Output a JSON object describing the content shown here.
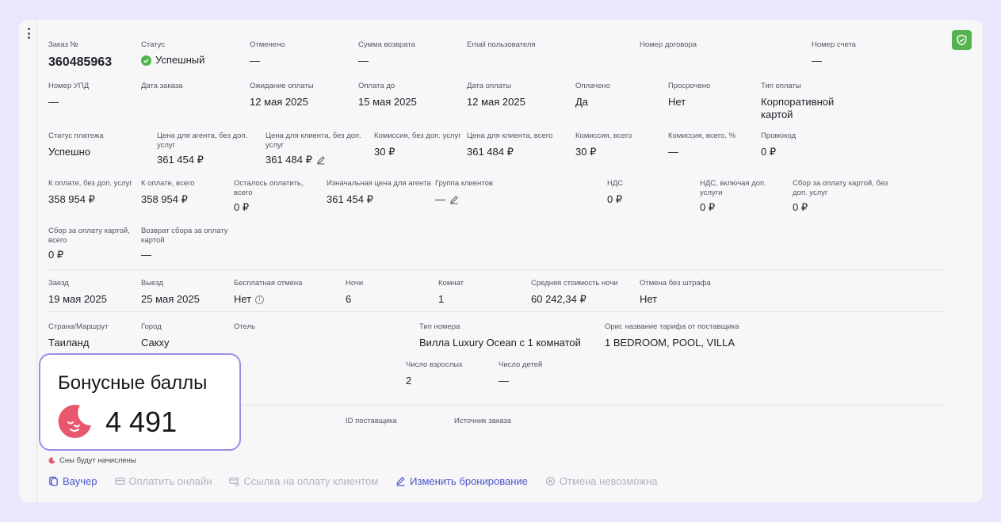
{
  "order": {
    "row1": [
      {
        "label": "Заказ №",
        "value": "360485963"
      },
      {
        "label": "Статус",
        "value": "Успешный"
      },
      {
        "label": "Отменено",
        "value": "—"
      },
      {
        "label": "Сумма возврата",
        "value": "—"
      },
      {
        "label": "Email пользователя",
        "value": ""
      },
      {
        "label": "Номер договора",
        "value": ""
      },
      {
        "label": "Номер счета",
        "value": "—"
      }
    ],
    "row2": [
      {
        "label": "Номер УПД",
        "value": "—"
      },
      {
        "label": "Дата заказа",
        "value": ""
      },
      {
        "label": "Ожидание оплаты",
        "value": "12 мая 2025"
      },
      {
        "label": "Оплата до",
        "value": "15 мая 2025"
      },
      {
        "label": "Дата оплаты",
        "value": "12 мая 2025"
      },
      {
        "label": "Оплачено",
        "value": "Да"
      },
      {
        "label": "Просрочено",
        "value": "Нет"
      },
      {
        "label": "Тип оплаты",
        "value": "Корпоративной картой"
      }
    ],
    "row3": [
      {
        "label": "Статус платежа",
        "value": "Успешно"
      },
      {
        "label": "Цена для агента, без доп. услуг",
        "value": "361 454 ₽"
      },
      {
        "label": "Цена для клиента, без доп. услуг",
        "value": "361 484 ₽"
      },
      {
        "label": "Комиссия, без доп. услуг",
        "value": "30 ₽"
      },
      {
        "label": "Цена для клиента, всего",
        "value": "361 484 ₽"
      },
      {
        "label": "Комиссия, всего",
        "value": "30 ₽"
      },
      {
        "label": "Комиссия, всего, %",
        "value": "—"
      },
      {
        "label": "Промокод",
        "value": "0 ₽"
      }
    ],
    "row4": [
      {
        "label": "К оплате, без доп. услуг",
        "value": "358 954 ₽"
      },
      {
        "label": "К оплате, всего",
        "value": "358 954 ₽"
      },
      {
        "label": "Осталось оплатить, всего",
        "value": "0 ₽"
      },
      {
        "label": "Изначальная цена для агента",
        "value": "361 454 ₽"
      },
      {
        "label": "Группа клиентов",
        "value": "—"
      },
      {
        "label": "НДС",
        "value": "0 ₽"
      },
      {
        "label": "НДС, включая доп. услуги",
        "value": "0 ₽"
      },
      {
        "label": "Сбор за оплату картой, без доп. услуг",
        "value": "0 ₽"
      }
    ],
    "row5": [
      {
        "label": "Сбор за оплату картой, всего",
        "value": "0 ₽"
      },
      {
        "label": "Возврат сбора за оплату картой",
        "value": "—"
      }
    ]
  },
  "stay": {
    "row1": [
      {
        "label": "Заезд",
        "value": "19 мая 2025"
      },
      {
        "label": "Выезд",
        "value": "25 мая 2025"
      },
      {
        "label": "Бесплатная отмена",
        "value": "Нет"
      },
      {
        "label": "Ночи",
        "value": "6"
      },
      {
        "label": "Комнат",
        "value": "1"
      },
      {
        "label": "Средняя стоимость ночи",
        "value": "60 242,34 ₽"
      },
      {
        "label": "Отмена без штрафа",
        "value": "Нет"
      }
    ],
    "row2": [
      {
        "label": "Страна/Маршрут",
        "value": "Таиланд"
      },
      {
        "label": "Город",
        "value": "Сакху"
      },
      {
        "label": "Отель",
        "value": ""
      },
      {
        "label": "Тип номера",
        "value": "Вилла Luxury Ocean с 1 комнатой"
      },
      {
        "label": "Ориг. название тарифа от поставщика",
        "value": "1 BEDROOM, POOL, VILLA"
      }
    ],
    "row3": [
      {
        "label": "Число взрослых",
        "value": "2"
      },
      {
        "label": "Число детей",
        "value": "—"
      }
    ]
  },
  "supplier": {
    "id_label": "ID поставщика",
    "source_label": "Источник заказа"
  },
  "bonus": {
    "title": "Бонусные баллы",
    "value": "4 491",
    "hint": "Сны будут начислены",
    "accent": "#e8576d"
  },
  "actions": [
    {
      "label": "Ваучер",
      "enabled": true
    },
    {
      "label": "Оплатить онлайн",
      "enabled": false
    },
    {
      "label": "Ссылка на оплату клиентом",
      "enabled": false
    },
    {
      "label": "Изменить бронирование",
      "enabled": true
    },
    {
      "label": "Отмена невозможна",
      "enabled": false
    }
  ],
  "colors": {
    "background": "#ebe6fb",
    "success": "#4fb548",
    "link": "#4a55c7",
    "disabled": "#b3b3bc",
    "shield": "#55b24e"
  },
  "icons": [
    "kebab-menu-icon",
    "shield-check-icon",
    "check-circle-icon",
    "pencil-icon",
    "info-icon",
    "moon-icon",
    "voucher-icon",
    "card-icon",
    "link-card-icon",
    "cancel-circle-icon"
  ]
}
